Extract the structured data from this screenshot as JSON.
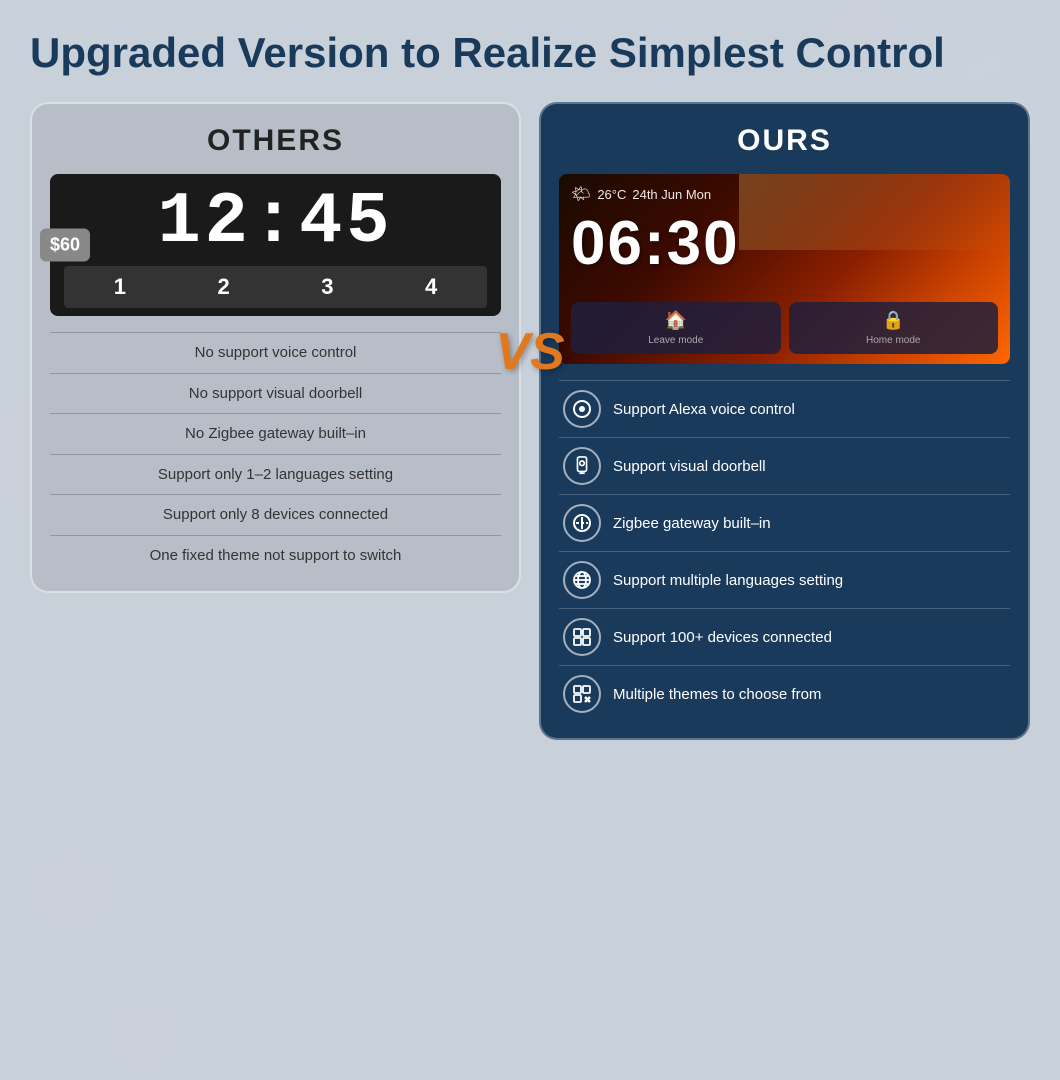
{
  "title": "Upgraded Version to Realize Simplest Control",
  "others": {
    "label": "OTHERS",
    "price": "$60",
    "time": "12:45",
    "digits": [
      "1",
      "2",
      "3",
      "4"
    ],
    "features": [
      "No support voice control",
      "No support visual doorbell",
      "No Zigbee gateway built–in",
      "Support only 1–2 languages setting",
      "Support only 8 devices connected",
      "One fixed theme not support to switch"
    ]
  },
  "vs_label": "VS",
  "ours": {
    "label": "OURS",
    "weather_icon": "🌤",
    "temperature": "26°C",
    "date": "24th Jun Mon",
    "time": "06:30",
    "modes": [
      {
        "icon": "🏠",
        "label": "Leave mode"
      },
      {
        "icon": "🔒",
        "label": "Home mode"
      }
    ],
    "features": [
      {
        "icon": "⊙",
        "text": "Support Alexa voice control"
      },
      {
        "icon": "📱",
        "text": "Support visual doorbell"
      },
      {
        "icon": "⊘",
        "text": "Zigbee gateway built–in"
      },
      {
        "icon": "🌐",
        "text": "Support multiple languages setting"
      },
      {
        "icon": "⊡",
        "text": "Support 100+ devices connected"
      },
      {
        "icon": "⊞",
        "text": "Multiple themes to choose from"
      }
    ]
  }
}
